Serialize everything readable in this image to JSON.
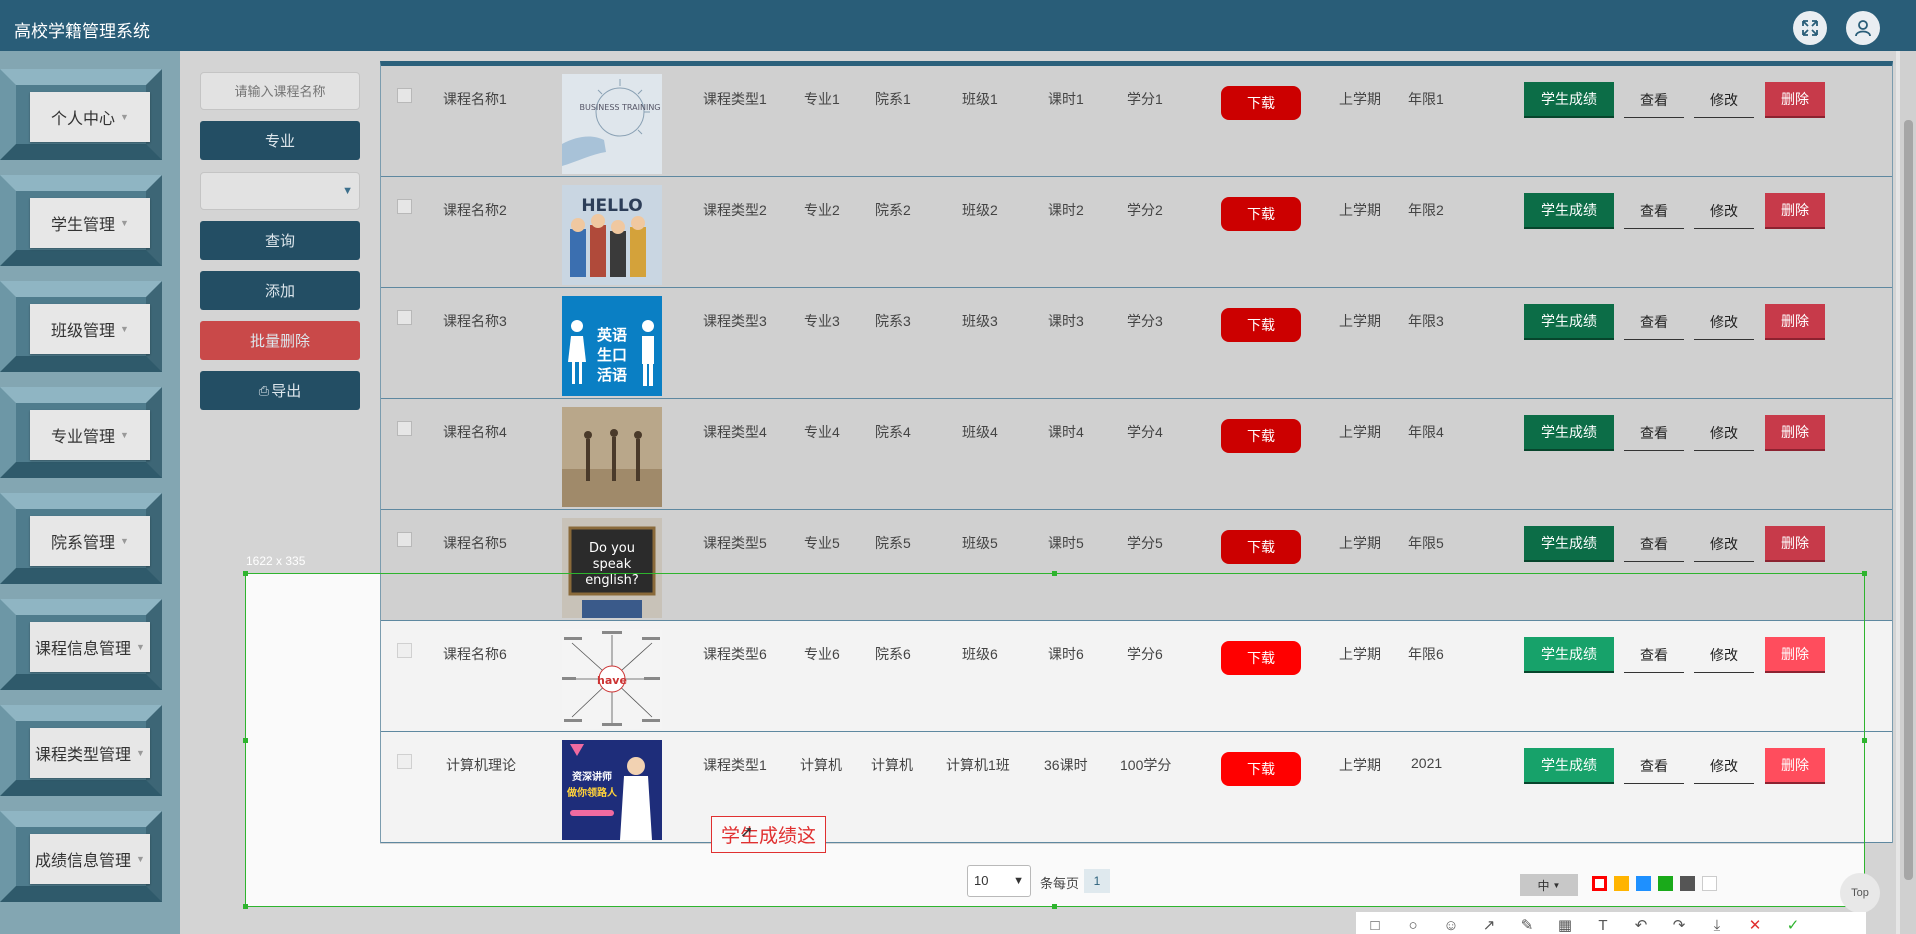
{
  "header": {
    "title": "高校学籍管理系统",
    "fullscreen_icon": "fullscreen-icon",
    "user_icon": "user-icon"
  },
  "sidebar": {
    "items": [
      {
        "label": "个人中心"
      },
      {
        "label": "学生管理"
      },
      {
        "label": "班级管理"
      },
      {
        "label": "专业管理"
      },
      {
        "label": "院系管理"
      },
      {
        "label": "课程信息管理"
      },
      {
        "label": "课程类型管理"
      },
      {
        "label": "成绩信息管理"
      }
    ]
  },
  "search": {
    "placeholder": "请输入课程名称",
    "major_label": "专业",
    "query_label": "查询",
    "add_label": "添加",
    "batch_delete_label": "批量删除",
    "export_label": "导出"
  },
  "table": {
    "download_label": "下载",
    "score_label": "学生成绩",
    "view_label": "查看",
    "edit_label": "修改",
    "delete_label": "删除",
    "rows": [
      {
        "name": "课程名称1",
        "type": "课程类型1",
        "major": "专业1",
        "dept": "院系1",
        "class": "班级1",
        "hours": "课时1",
        "credit": "学分1",
        "term": "上学期",
        "years": "年限1",
        "image": "business-training"
      },
      {
        "name": "课程名称2",
        "type": "课程类型2",
        "major": "专业2",
        "dept": "院系2",
        "class": "班级2",
        "hours": "课时2",
        "credit": "学分2",
        "term": "上学期",
        "years": "年限2",
        "image": "hello-kids"
      },
      {
        "name": "课程名称3",
        "type": "课程类型3",
        "major": "专业3",
        "dept": "院系3",
        "class": "班级3",
        "hours": "课时3",
        "credit": "学分3",
        "term": "上学期",
        "years": "年限3",
        "image": "english-speaking"
      },
      {
        "name": "课程名称4",
        "type": "课程类型4",
        "major": "专业4",
        "dept": "院系4",
        "class": "班级4",
        "hours": "课时4",
        "credit": "学分4",
        "term": "上学期",
        "years": "年限4",
        "image": "dancers"
      },
      {
        "name": "课程名称5",
        "type": "课程类型5",
        "major": "专业5",
        "dept": "院系5",
        "class": "班级5",
        "hours": "课时5",
        "credit": "学分5",
        "term": "上学期",
        "years": "年限5",
        "image": "do-you-speak-english"
      },
      {
        "name": "课程名称6",
        "type": "课程类型6",
        "major": "专业6",
        "dept": "院系6",
        "class": "班级6",
        "hours": "课时6",
        "credit": "学分6",
        "term": "上学期",
        "years": "年限6",
        "image": "have-mindmap"
      },
      {
        "name": "计算机理论",
        "type": "课程类型1",
        "major": "计算机",
        "dept": "计算机",
        "class": "计算机1班",
        "hours": "36课时",
        "credit": "100学分",
        "term": "上学期",
        "years": "2021",
        "image": "teacher-poster"
      }
    ]
  },
  "image_text": {
    "img1": "BUSINESS TRAINING",
    "img2": "HELLO",
    "img3a": "英语",
    "img3b": "生口",
    "img3c": "活语",
    "img5a": "Do you",
    "img5b": "speak",
    "img5c": "english?",
    "img6": "have",
    "img7a": "资深讲师",
    "img7b": "做你领路人"
  },
  "pagination": {
    "page_size": "10",
    "per_page_label": "条每页",
    "current_page": "1"
  },
  "capture_overlay": {
    "size_label": "1622 x 335",
    "annotation_text": "学生成绩这",
    "font_size_label": "中",
    "colors": [
      "#ff0000",
      "#ffb400",
      "#1e90ff",
      "#1aaa1a",
      "#555555",
      "#ffffff"
    ],
    "top_label": "Top"
  }
}
